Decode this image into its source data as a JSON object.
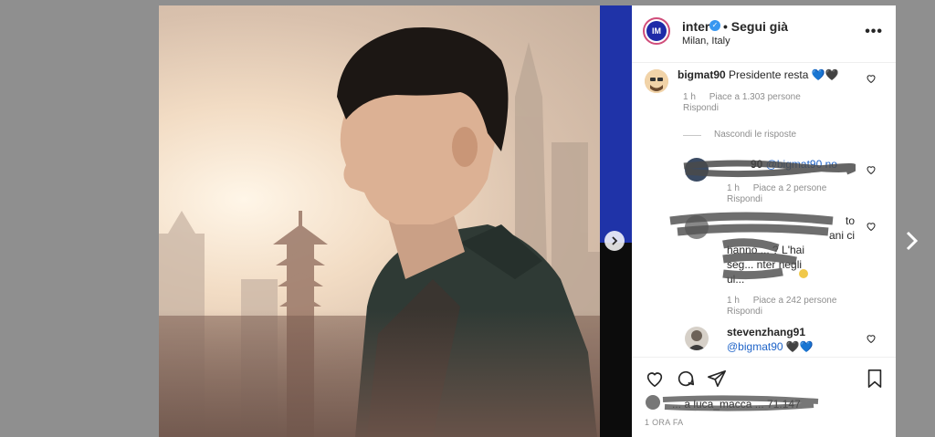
{
  "post": {
    "username": "inter",
    "follow_label": "• Segui già",
    "location": "Milan, Italy",
    "avatar_initials": "IM",
    "more_icon": "more-horizontal-icon"
  },
  "comments": [
    {
      "username": "bigmat90",
      "text": "Presidente resta",
      "emoji": "💙🖤",
      "time": "1 h",
      "likes": "Piace a 1.303 persone",
      "reply": "Rispondi"
    }
  ],
  "hide_replies_label": "Nascondi le risposte",
  "replies": [
    {
      "username_partial": "90",
      "text_partial": "@bigmat90 no",
      "time": "1 h",
      "likes": "Piace a 2 persone",
      "reply": "Rispondi"
    },
    {
      "lines": [
        "to",
        "ani ci",
        "hanno ... ? L'hai",
        "seg... nter negli",
        "ul..."
      ],
      "time": "1 h",
      "likes": "Piace a 242 persone",
      "reply": "Rispondi"
    },
    {
      "username": "stevenzhang91",
      "mention": "@bigmat90",
      "emoji": "🖤💙"
    }
  ],
  "footer": {
    "likes_partial": "... a luca_macca ... 71.147",
    "time": "1 ORA FA"
  },
  "colors": {
    "blue_strip": "#1f33a8",
    "verified": "#3897f0",
    "mention": "#1e63c8"
  }
}
